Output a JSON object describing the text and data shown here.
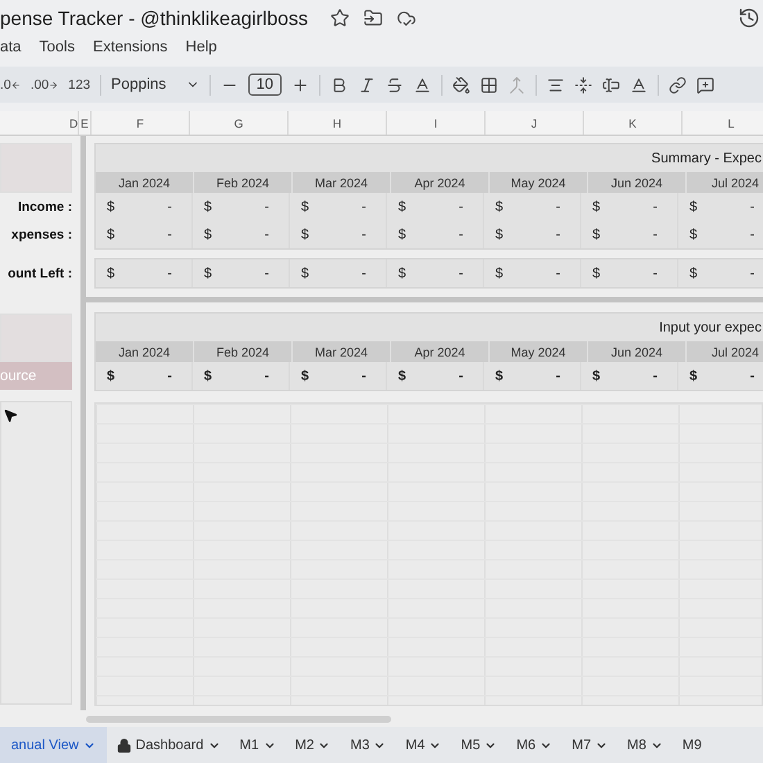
{
  "title": "pense Tracker - @thinklikeagirlboss",
  "menu": [
    "ata",
    "Tools",
    "Extensions",
    "Help"
  ],
  "toolbar": {
    "decimal_decrease": ".0",
    "decimal_increase": ".00",
    "number_format": "123",
    "font": "Poppins",
    "font_size": "10"
  },
  "columns": [
    "D",
    "E",
    "F",
    "G",
    "H",
    "I",
    "J",
    "K",
    "L"
  ],
  "summary": {
    "title": "Summary - Expec",
    "months": [
      "Jan 2024",
      "Feb 2024",
      "Mar 2024",
      "Apr 2024",
      "May 2024",
      "Jun 2024",
      "Jul 2024"
    ],
    "rows": [
      {
        "label": "Income :",
        "values": [
          {
            "symbol": "$",
            "amount": "-"
          },
          {
            "symbol": "$",
            "amount": "-"
          },
          {
            "symbol": "$",
            "amount": "-"
          },
          {
            "symbol": "$",
            "amount": "-"
          },
          {
            "symbol": "$",
            "amount": "-"
          },
          {
            "symbol": "$",
            "amount": "-"
          },
          {
            "symbol": "$",
            "amount": "-"
          }
        ]
      },
      {
        "label": "xpenses :",
        "values": [
          {
            "symbol": "$",
            "amount": "-"
          },
          {
            "symbol": "$",
            "amount": "-"
          },
          {
            "symbol": "$",
            "amount": "-"
          },
          {
            "symbol": "$",
            "amount": "-"
          },
          {
            "symbol": "$",
            "amount": "-"
          },
          {
            "symbol": "$",
            "amount": "-"
          },
          {
            "symbol": "$",
            "amount": "-"
          }
        ]
      }
    ],
    "total": {
      "label": "ount Left :",
      "values": [
        {
          "symbol": "$",
          "amount": "-"
        },
        {
          "symbol": "$",
          "amount": "-"
        },
        {
          "symbol": "$",
          "amount": "-"
        },
        {
          "symbol": "$",
          "amount": "-"
        },
        {
          "symbol": "$",
          "amount": "-"
        },
        {
          "symbol": "$",
          "amount": "-"
        },
        {
          "symbol": "$",
          "amount": "-"
        }
      ]
    }
  },
  "input": {
    "title": "Input your expec",
    "label": "ource",
    "months": [
      "Jan 2024",
      "Feb 2024",
      "Mar 2024",
      "Apr 2024",
      "May 2024",
      "Jun 2024",
      "Jul 2024"
    ],
    "values": [
      {
        "symbol": "$",
        "amount": "-"
      },
      {
        "symbol": "$",
        "amount": "-"
      },
      {
        "symbol": "$",
        "amount": "-"
      },
      {
        "symbol": "$",
        "amount": "-"
      },
      {
        "symbol": "$",
        "amount": "-"
      },
      {
        "symbol": "$",
        "amount": "-"
      },
      {
        "symbol": "$",
        "amount": "-"
      }
    ]
  },
  "tabs": [
    {
      "label": "anual View",
      "selected": true,
      "locked": false
    },
    {
      "label": "Dashboard",
      "selected": false,
      "locked": true
    },
    {
      "label": "M1",
      "selected": false,
      "locked": false
    },
    {
      "label": "M2",
      "selected": false,
      "locked": false
    },
    {
      "label": "M3",
      "selected": false,
      "locked": false
    },
    {
      "label": "M4",
      "selected": false,
      "locked": false
    },
    {
      "label": "M5",
      "selected": false,
      "locked": false
    },
    {
      "label": "M6",
      "selected": false,
      "locked": false
    },
    {
      "label": "M7",
      "selected": false,
      "locked": false
    },
    {
      "label": "M8",
      "selected": false,
      "locked": false
    },
    {
      "label": "M9",
      "selected": false,
      "locked": false
    }
  ]
}
